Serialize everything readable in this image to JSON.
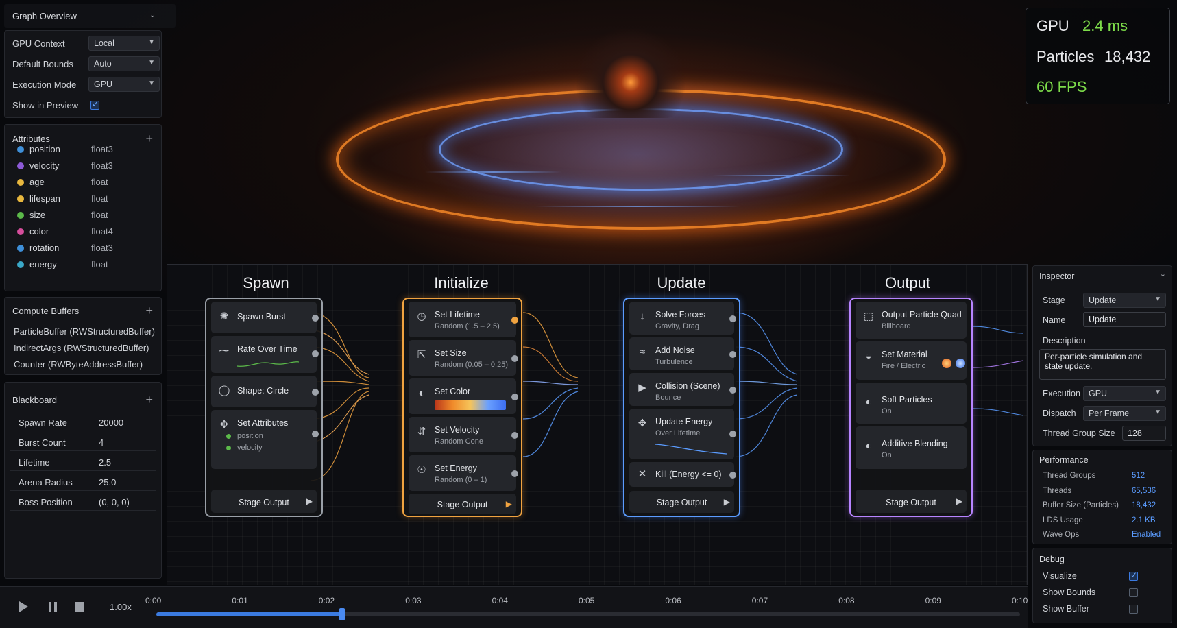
{
  "graph_overview": {
    "title": "Graph Overview",
    "rows": [
      {
        "label": "GPU Context",
        "value": "Local"
      },
      {
        "label": "Default Bounds",
        "value": "Auto"
      },
      {
        "label": "Execution Mode",
        "value": "GPU"
      }
    ],
    "show_in_preview": {
      "label": "Show in Preview",
      "checked": true
    }
  },
  "attributes": {
    "title": "Attributes",
    "items": [
      {
        "name": "position",
        "type": "float3",
        "color": "#3e8fd8"
      },
      {
        "name": "velocity",
        "type": "float3",
        "color": "#8d5ad6"
      },
      {
        "name": "age",
        "type": "float",
        "color": "#e8b73e"
      },
      {
        "name": "lifespan",
        "type": "float",
        "color": "#e8b73e"
      },
      {
        "name": "size",
        "type": "float",
        "color": "#5cba4a"
      },
      {
        "name": "color",
        "type": "float4",
        "color": "#d64e9c"
      },
      {
        "name": "rotation",
        "type": "float3",
        "color": "#3e8fd8"
      },
      {
        "name": "energy",
        "type": "float",
        "color": "#3aa8c8"
      }
    ]
  },
  "compute_buffers": {
    "title": "Compute Buffers",
    "items": [
      "ParticleBuffer (RWStructuredBuffer)",
      "IndirectArgs (RWStructuredBuffer)",
      "Counter (RWByteAddressBuffer)"
    ]
  },
  "blackboard": {
    "title": "Blackboard",
    "rows": [
      {
        "key": "Spawn Rate",
        "value": "20000"
      },
      {
        "key": "Burst Count",
        "value": "4"
      },
      {
        "key": "Lifetime",
        "value": "2.5"
      },
      {
        "key": "Arena Radius",
        "value": "25.0"
      },
      {
        "key": "Boss Position",
        "value": "(0, 0, 0)"
      }
    ]
  },
  "stats": {
    "gpu_label": "GPU",
    "gpu_value": "2.4 ms",
    "particles_label": "Particles",
    "particles_value": "18,432",
    "fps": "60 FPS"
  },
  "stages": {
    "spawn": {
      "title": "Spawn",
      "nodes": [
        {
          "title": "Spawn Burst"
        },
        {
          "title": "Rate Over Time"
        },
        {
          "title": "Shape: Circle"
        },
        {
          "title": "Set Attributes",
          "attrs": [
            "position",
            "velocity"
          ]
        }
      ],
      "output": "Stage Output"
    },
    "initialize": {
      "title": "Initialize",
      "nodes": [
        {
          "title": "Set Lifetime",
          "sub": "Random (1.5 – 2.5)"
        },
        {
          "title": "Set Size",
          "sub": "Random (0.05 – 0.25)"
        },
        {
          "title": "Set Color"
        },
        {
          "title": "Set Velocity",
          "sub": "Random Cone"
        },
        {
          "title": "Set Energy",
          "sub": "Random (0 – 1)"
        }
      ],
      "output": "Stage Output"
    },
    "update": {
      "title": "Update",
      "nodes": [
        {
          "title": "Solve Forces",
          "sub": "Gravity, Drag"
        },
        {
          "title": "Add Noise",
          "sub": "Turbulence"
        },
        {
          "title": "Collision (Scene)",
          "sub": "Bounce"
        },
        {
          "title": "Update Energy",
          "sub": "Over Lifetime"
        },
        {
          "title": "Kill (Energy <= 0)"
        }
      ],
      "output": "Stage Output"
    },
    "output": {
      "title": "Output",
      "nodes": [
        {
          "title": "Output Particle Quad",
          "sub": "Billboard"
        },
        {
          "title": "Set Material",
          "sub": "Fire / Electric"
        },
        {
          "title": "Soft Particles",
          "sub": "On"
        },
        {
          "title": "Additive Blending",
          "sub": "On"
        }
      ],
      "output": "Stage Output"
    }
  },
  "inspector": {
    "title": "Inspector",
    "stage_label": "Stage",
    "stage_value": "Update",
    "name_label": "Name",
    "name_value": "Update",
    "description_label": "Description",
    "description_value": "Per-particle simulation and state update.",
    "execution_label": "Execution",
    "execution_value": "GPU",
    "dispatch_label": "Dispatch",
    "dispatch_value": "Per Frame",
    "thread_group_label": "Thread Group Size",
    "thread_group_value": "128",
    "performance": {
      "title": "Performance",
      "rows": [
        {
          "key": "Thread Groups",
          "value": "512"
        },
        {
          "key": "Threads",
          "value": "65,536"
        },
        {
          "key": "Buffer Size (Particles)",
          "value": "18,432"
        },
        {
          "key": "LDS Usage",
          "value": "2.1 KB"
        },
        {
          "key": "Wave Ops",
          "value": "Enabled"
        }
      ]
    },
    "debug": {
      "title": "Debug",
      "rows": [
        {
          "label": "Visualize",
          "checked": true
        },
        {
          "label": "Show Bounds",
          "checked": false
        },
        {
          "label": "Show Buffer",
          "checked": false
        }
      ]
    }
  },
  "timeline": {
    "speed": "1.00x",
    "ticks": [
      "0:00",
      "0:01",
      "0:02",
      "0:03",
      "0:04",
      "0:05",
      "0:06",
      "0:07",
      "0:08",
      "0:09",
      "0:10"
    ],
    "playhead_fraction": 0.215
  },
  "colors": {
    "spawn": "#9aa0a8",
    "initialize": "#f0a340",
    "update": "#5b9cff",
    "output": "#b784ff",
    "accent": "#3b7be0",
    "fps_green": "#7ddc4a"
  }
}
